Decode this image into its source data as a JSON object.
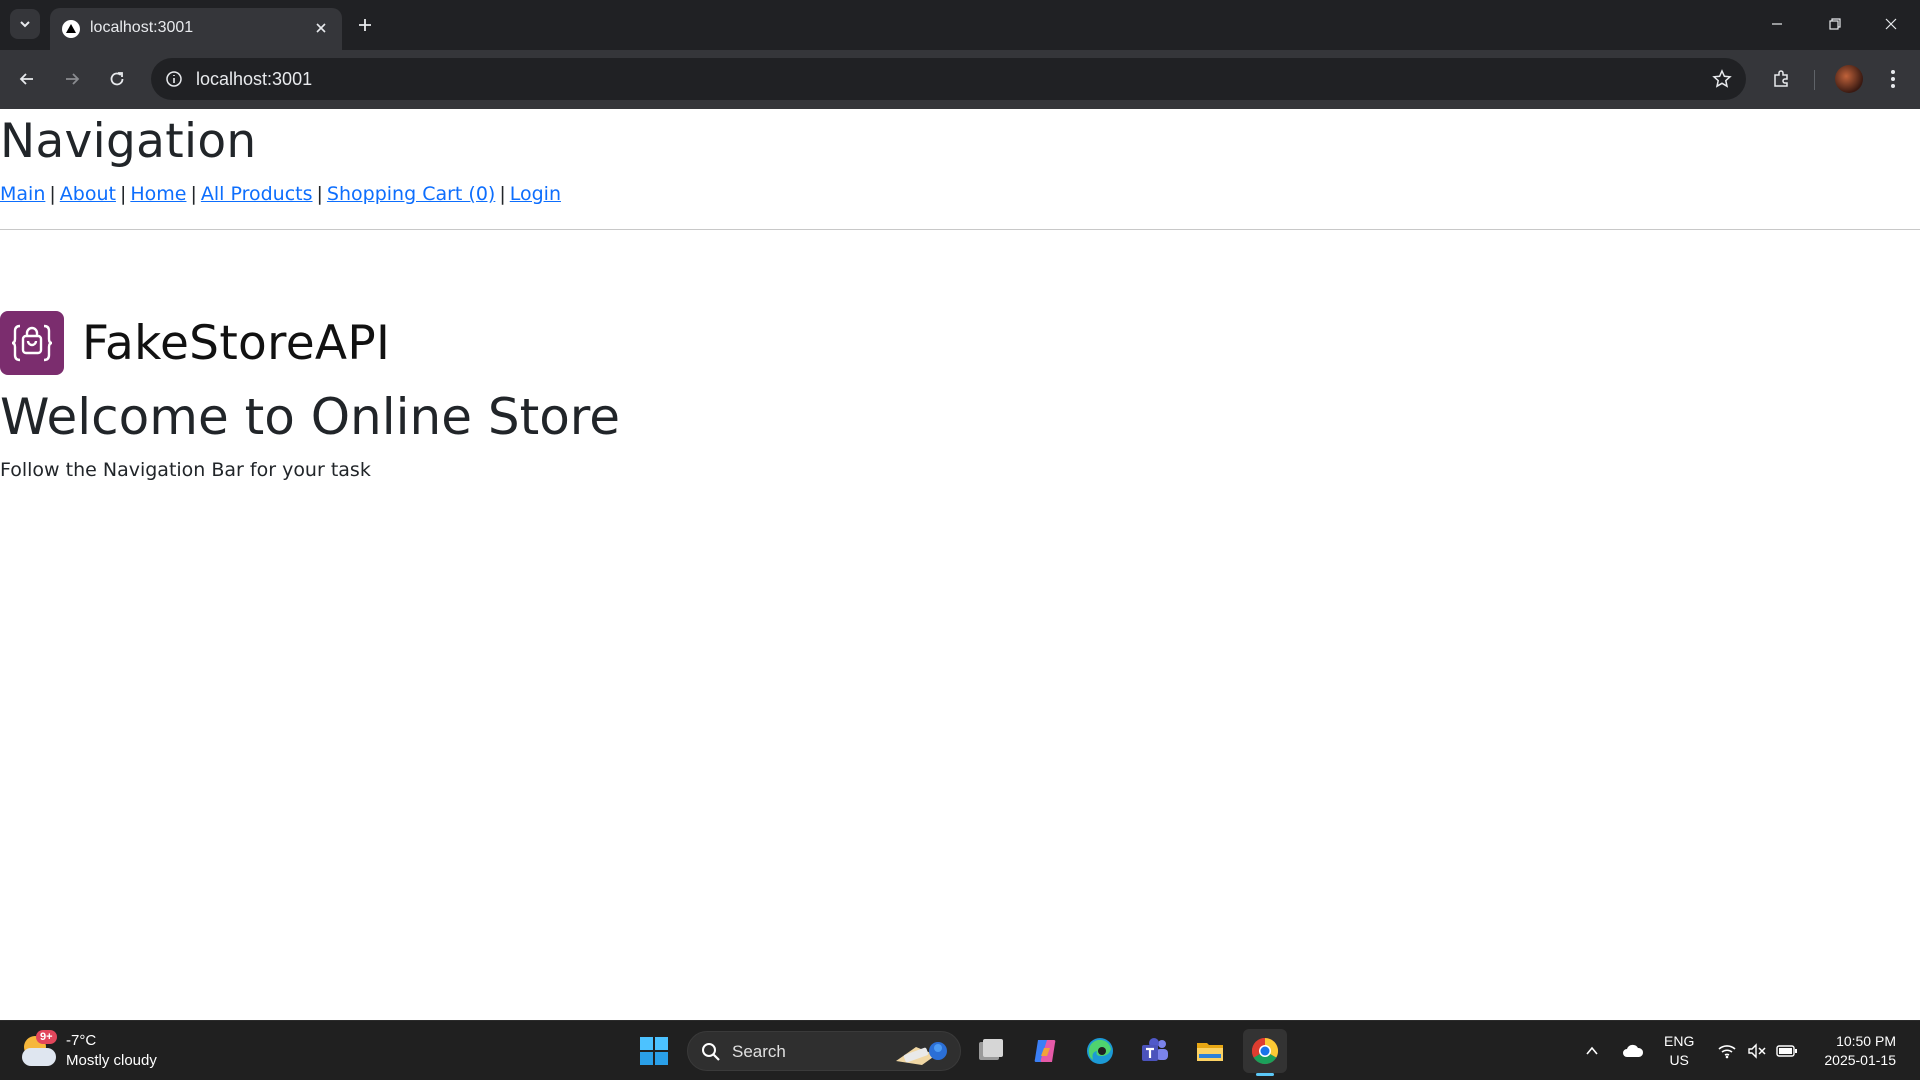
{
  "browser": {
    "tab_title": "localhost:3001",
    "url": "localhost:3001"
  },
  "page": {
    "nav_heading": "Navigation",
    "nav_links": [
      {
        "label": "Main"
      },
      {
        "label": "About"
      },
      {
        "label": "Home"
      },
      {
        "label": "All Products"
      },
      {
        "label": "Shopping Cart (0)"
      },
      {
        "label": "Login"
      }
    ],
    "separator": "|",
    "brand_name": "FakeStoreAPI",
    "welcome_title": "Welcome to Online Store",
    "subtext": "Follow the Navigation Bar for your task",
    "link_color": "#0d6efd",
    "logo_color": "#7b2d6e"
  },
  "taskbar": {
    "weather": {
      "badge": "9+",
      "temperature": "-7°C",
      "description": "Mostly cloudy"
    },
    "search_label": "Search",
    "language": {
      "line1": "ENG",
      "line2": "US"
    },
    "clock": {
      "time": "10:50 PM",
      "date": "2025-01-15"
    },
    "pinned_apps": [
      "start-icon",
      "search",
      "task-view-icon",
      "copilot-icon",
      "edge-icon",
      "teams-icon",
      "file-explorer-icon",
      "chrome-icon"
    ]
  }
}
